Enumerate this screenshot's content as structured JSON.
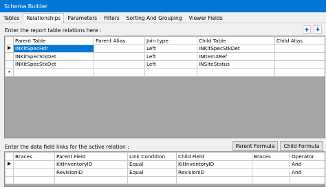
{
  "window": {
    "title": "Schema Builder"
  },
  "tabs": [
    "Tables",
    "Relationships",
    "Parameters",
    "Filters",
    "Sorting And Grouping",
    "Viewer Fields"
  ],
  "relations": {
    "label": "Enter the report table relations here :",
    "columns": [
      "Parent Table",
      "Parent Alias",
      "Join type",
      "Child Table",
      "Child Alias"
    ],
    "rows": [
      [
        "INKitSpecHdr",
        "",
        "Left",
        "INKitSpecStkDet",
        ""
      ],
      [
        "INKitSpecStkDet",
        "",
        "Left",
        "INItemXRef",
        ""
      ],
      [
        "INKitSpecStkDet",
        "",
        "Left",
        "INSiteStatus",
        ""
      ]
    ],
    "new_row_marker": "*"
  },
  "links": {
    "label": "Enter the data field links for the active relation :",
    "parent_formula_button": "Parent Formula",
    "child_formula_button": "Child Formula",
    "columns": [
      "Braces",
      "Parent Field",
      "Link Condition",
      "Child Field",
      "Braces",
      "Operator"
    ],
    "rows": [
      [
        "",
        "KitInventoryID",
        "Equal",
        "KitInventoryID",
        "",
        "And"
      ],
      [
        "",
        "RevisionID",
        "Equal",
        "RevisionID",
        "",
        "And"
      ]
    ]
  },
  "colors": {
    "accent": "#0078d7",
    "grid_background": "#a5a5a5"
  }
}
